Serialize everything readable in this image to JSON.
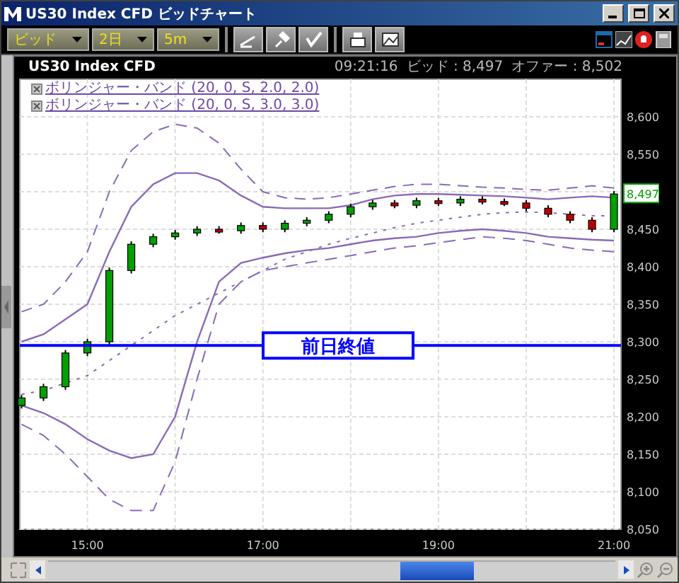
{
  "window": {
    "title": "US30 Index CFD ビッドチャート"
  },
  "toolbar": {
    "dropdowns": [
      "ビッド",
      "2日",
      "5m"
    ]
  },
  "chart_header": {
    "symbol": "US30 Index CFD",
    "time": "09:21:16",
    "bid": "ビッド : 8,497",
    "offer": "オファー : 8,502"
  },
  "legend": [
    "ボリンジャー・バンド (20, 0, S, 2.0, 2.0)",
    "ボリンジャー・バンド (20, 0, S, 3.0, 3.0)"
  ],
  "last_price_label": "8,497",
  "chart_data": {
    "type": "candlestick",
    "x": [
      14.25,
      14.5,
      14.75,
      15,
      15.25,
      15.5,
      15.75,
      16,
      16.25,
      16.5,
      16.75,
      17,
      17.25,
      17.5,
      17.75,
      18,
      18.25,
      18.5,
      18.75,
      19,
      19.25,
      19.5,
      19.75,
      20,
      20.25,
      20.5,
      20.75,
      21
    ],
    "ohlc": [
      [
        8215,
        8229,
        8211,
        8225
      ],
      [
        8225,
        8244,
        8221,
        8240
      ],
      [
        8240,
        8289,
        8236,
        8285
      ],
      [
        8285,
        8304,
        8281,
        8300
      ],
      [
        8300,
        8399,
        8296,
        8395
      ],
      [
        8395,
        8434,
        8391,
        8430
      ],
      [
        8430,
        8444,
        8426,
        8440
      ],
      [
        8440,
        8449,
        8436,
        8445
      ],
      [
        8445,
        8454,
        8441,
        8450
      ],
      [
        8450,
        8454,
        8444,
        8448
      ],
      [
        8448,
        8459,
        8444,
        8455
      ],
      [
        8455,
        8459,
        8446,
        8450
      ],
      [
        8450,
        8462,
        8446,
        8458
      ],
      [
        8458,
        8466,
        8454,
        8462
      ],
      [
        8462,
        8474,
        8458,
        8470
      ],
      [
        8470,
        8484,
        8466,
        8480
      ],
      [
        8480,
        8489,
        8476,
        8485
      ],
      [
        8485,
        8489,
        8478,
        8482
      ],
      [
        8482,
        8492,
        8478,
        8488
      ],
      [
        8488,
        8492,
        8481,
        8485
      ],
      [
        8485,
        8494,
        8481,
        8490
      ],
      [
        8490,
        8494,
        8483,
        8487
      ],
      [
        8487,
        8491,
        8481,
        8485
      ],
      [
        8485,
        8489,
        8474,
        8478
      ],
      [
        8478,
        8482,
        8466,
        8470
      ],
      [
        8470,
        8474,
        8458,
        8462
      ],
      [
        8462,
        8466,
        8446,
        8450
      ],
      [
        8450,
        8501,
        8446,
        8497
      ]
    ],
    "series": [
      {
        "type": "line",
        "line_style": "dotted",
        "color": "#8a6ab8",
        "values": [
          8230,
          8235,
          8245,
          8255,
          8275,
          8295,
          8315,
          8335,
          8350,
          8365,
          8380,
          8395,
          8410,
          8420,
          8430,
          8438,
          8445,
          8452,
          8458,
          8462,
          8466,
          8470,
          8472,
          8473,
          8472,
          8470,
          8468,
          8468
        ]
      },
      {
        "type": "line",
        "line_style": "solid",
        "color": "#8a6ab8",
        "values": [
          8300,
          8310,
          8330,
          8350,
          8420,
          8480,
          8510,
          8525,
          8525,
          8515,
          8495,
          8480,
          8478,
          8478,
          8478,
          8482,
          8490,
          8495,
          8497,
          8497,
          8496,
          8495,
          8494,
          8492,
          8490,
          8492,
          8494,
          8492
        ]
      },
      {
        "type": "line",
        "line_style": "solid",
        "color": "#8a6ab8",
        "values": [
          8215,
          8205,
          8190,
          8170,
          8155,
          8145,
          8150,
          8200,
          8300,
          8380,
          8405,
          8412,
          8418,
          8422,
          8425,
          8430,
          8435,
          8438,
          8440,
          8445,
          8448,
          8450,
          8448,
          8445,
          8440,
          8438,
          8436,
          8435
        ]
      },
      {
        "type": "line",
        "line_style": "dashed",
        "color": "#8a6ab8",
        "values": [
          8340,
          8350,
          8380,
          8420,
          8500,
          8555,
          8580,
          8590,
          8585,
          8565,
          8530,
          8500,
          8492,
          8490,
          8492,
          8497,
          8502,
          8507,
          8510,
          8510,
          8508,
          8506,
          8505,
          8503,
          8502,
          8505,
          8508,
          8505
        ]
      },
      {
        "type": "line",
        "line_style": "dashed",
        "color": "#8a6ab8",
        "values": [
          8190,
          8175,
          8150,
          8120,
          8090,
          8075,
          8075,
          8140,
          8250,
          8350,
          8380,
          8395,
          8400,
          8405,
          8410,
          8415,
          8420,
          8425,
          8428,
          8432,
          8436,
          8440,
          8438,
          8435,
          8430,
          8425,
          8422,
          8420
        ]
      }
    ],
    "xlim": [
      14.23,
      21.08
    ],
    "ylim": [
      8050,
      8650
    ],
    "yticks": [
      {
        "value": 8050,
        "label": "8,050"
      },
      {
        "value": 8100,
        "label": "8,100"
      },
      {
        "value": 8150,
        "label": "8,150"
      },
      {
        "value": 8200,
        "label": "8,200"
      },
      {
        "value": 8250,
        "label": "8,250"
      },
      {
        "value": 8300,
        "label": "8,300"
      },
      {
        "value": 8350,
        "label": "8,350"
      },
      {
        "value": 8400,
        "label": "8,400"
      },
      {
        "value": 8450,
        "label": "8,450"
      },
      {
        "value": 8550,
        "label": "8,550"
      },
      {
        "value": 8600,
        "label": "8,600"
      }
    ],
    "xticks": [
      {
        "value": 15,
        "label": "15:00"
      },
      {
        "value": 17,
        "label": "17:00"
      },
      {
        "value": 19,
        "label": "19:00"
      },
      {
        "value": 21,
        "label": "21:00"
      }
    ],
    "grid": true,
    "ref_lines": [
      {
        "axis": "y",
        "value": 8295,
        "label": "前日終値",
        "color": "#0000ff"
      }
    ]
  }
}
